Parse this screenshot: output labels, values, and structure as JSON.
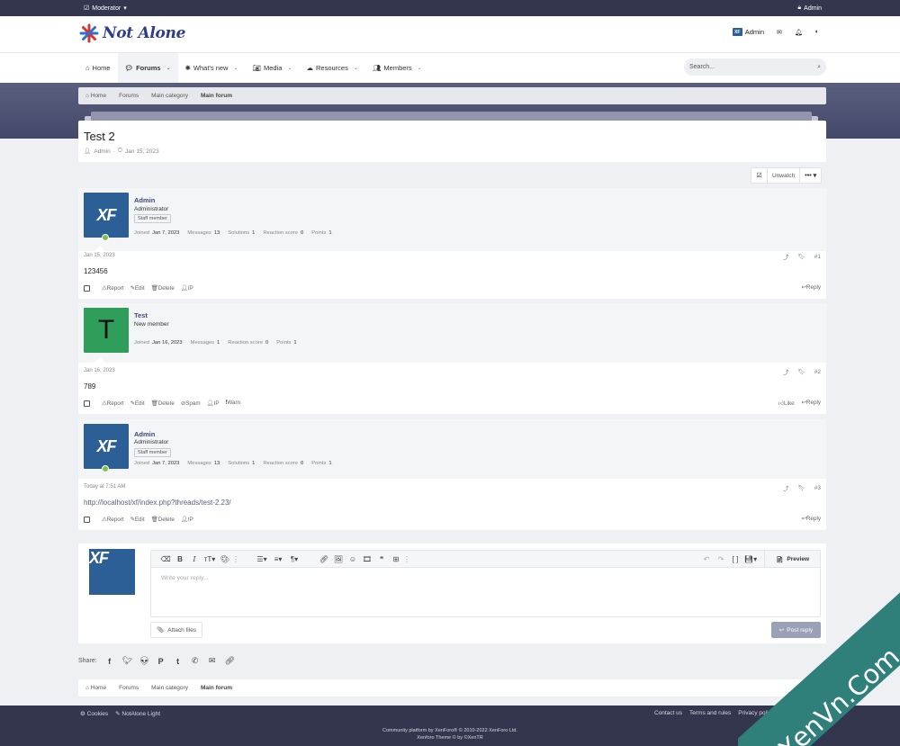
{
  "staffbar": {
    "moderator": "Moderator",
    "admin": "Admin"
  },
  "header": {
    "logo": "Not Alone",
    "user": "Admin"
  },
  "nav": {
    "tabs": [
      {
        "label": "Home"
      },
      {
        "label": "Forums"
      },
      {
        "label": "What's new"
      },
      {
        "label": "Media"
      },
      {
        "label": "Resources"
      },
      {
        "label": "Members"
      }
    ],
    "search_placeholder": "Search..."
  },
  "breadcrumb": [
    "Home",
    "Forums",
    "Main category",
    "Main forum"
  ],
  "thread": {
    "title": "Test 2",
    "author": "Admin",
    "date": "Jan 15, 2023"
  },
  "watch": {
    "unwatch": "Unwatch",
    "more": "•••"
  },
  "posts": [
    {
      "username": "Admin",
      "user_title": "Administrator",
      "badge": "Staff member",
      "stats": [
        {
          "label": "Joined",
          "value": "Jan 7, 2023"
        },
        {
          "label": "Messages",
          "value": "13"
        },
        {
          "label": "Solutions",
          "value": "1"
        },
        {
          "label": "Reaction score",
          "value": "0"
        },
        {
          "label": "Points",
          "value": "1"
        }
      ],
      "date": "Jan 15, 2023",
      "number": "#1",
      "body": "123456",
      "actions": [
        "Report",
        "Edit",
        "Delete",
        "IP"
      ],
      "reactions": [
        "Reply"
      ]
    },
    {
      "username": "Test",
      "user_title": "New member",
      "avatar_letter": "T",
      "stats": [
        {
          "label": "Joined",
          "value": "Jan 16, 2023"
        },
        {
          "label": "Messages",
          "value": "1"
        },
        {
          "label": "Reaction score",
          "value": "0"
        },
        {
          "label": "Points",
          "value": "1"
        }
      ],
      "date": "Jan 16, 2023",
      "number": "#2",
      "body": "789",
      "actions": [
        "Report",
        "Edit",
        "Delete",
        "Spam",
        "IP",
        "Warn"
      ],
      "reactions": [
        "Like",
        "Reply"
      ]
    },
    {
      "username": "Admin",
      "user_title": "Administrator",
      "badge": "Staff member",
      "stats": [
        {
          "label": "Joined",
          "value": "Jan 7, 2023"
        },
        {
          "label": "Messages",
          "value": "13"
        },
        {
          "label": "Solutions",
          "value": "1"
        },
        {
          "label": "Reaction score",
          "value": "0"
        },
        {
          "label": "Points",
          "value": "1"
        }
      ],
      "date": "Today at 7:51 AM",
      "number": "#3",
      "body": "http://localhost/xf/index.php?threads/test-2.23/",
      "actions": [
        "Report",
        "Edit",
        "Delete",
        "IP"
      ],
      "reactions": [
        "Reply"
      ]
    }
  ],
  "editor": {
    "placeholder": "Write your reply...",
    "preview": "Preview",
    "attach": "Attach files",
    "post_reply": "Post reply"
  },
  "share": {
    "label": "Share:"
  },
  "footer": {
    "left": [
      "Cookies",
      "NotAlone Light"
    ],
    "right": [
      "Contact us",
      "Terms and rules",
      "Privacy policy"
    ],
    "copyright": "Community platform by XenForo® © 2010-2022 XenForo Ltd.",
    "theme": "Xenforo Theme © by ©XenTR"
  },
  "watermark": "XenVn.Com",
  "avatar_text": "XF",
  "colors": {
    "accent": "#3a4a7a",
    "staffbar": "#33364e",
    "online": "#7cc242"
  }
}
